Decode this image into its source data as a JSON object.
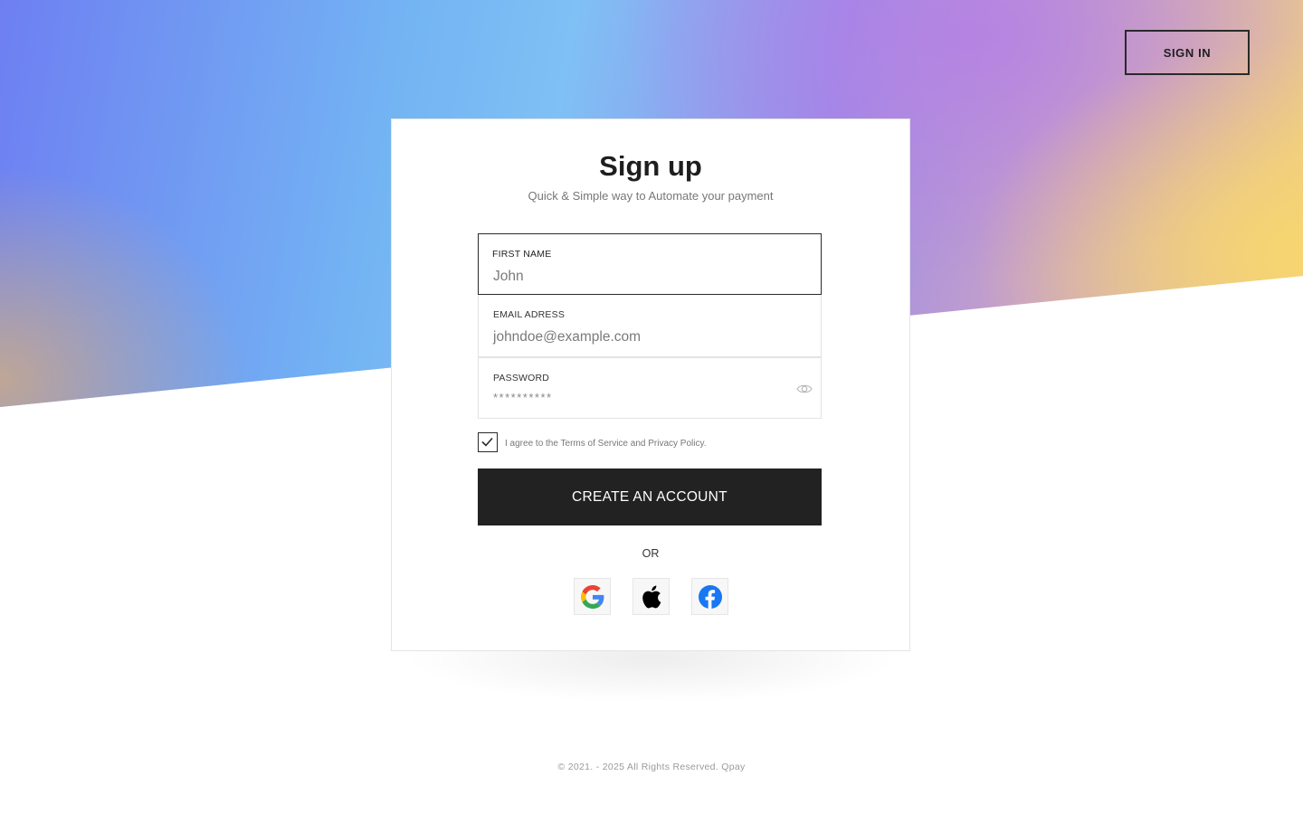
{
  "header": {
    "sign_in_label": "SIGN IN"
  },
  "form": {
    "title": "Sign up",
    "subtitle": "Quick & Simple way to Automate your payment",
    "fields": {
      "first_name": {
        "label": "FIRST NAME",
        "value": "John"
      },
      "email": {
        "label": "EMAIL ADRESS",
        "value": "johndoe@example.com"
      },
      "password": {
        "label": "PASSWORD",
        "value": "**********",
        "toggle_icon": "eye-icon"
      }
    },
    "terms": {
      "checked": true,
      "text": "I agree to the Terms of Service and Privacy Policy."
    },
    "submit_label": "CREATE AN ACCOUNT",
    "divider_text": "OR",
    "social_providers": [
      {
        "name": "Google",
        "icon": "google-icon"
      },
      {
        "name": "Apple",
        "icon": "apple-icon"
      },
      {
        "name": "Facebook",
        "icon": "facebook-icon"
      }
    ]
  },
  "footer": {
    "copyright": "© 2021. - 2025 All Rights Reserved. Qpay"
  },
  "colors": {
    "primary_button": "#222222",
    "facebook_blue": "#1877F2",
    "google_blue": "#4285F4",
    "google_red": "#EA4335",
    "google_yellow": "#FBBC05",
    "google_green": "#34A853"
  }
}
